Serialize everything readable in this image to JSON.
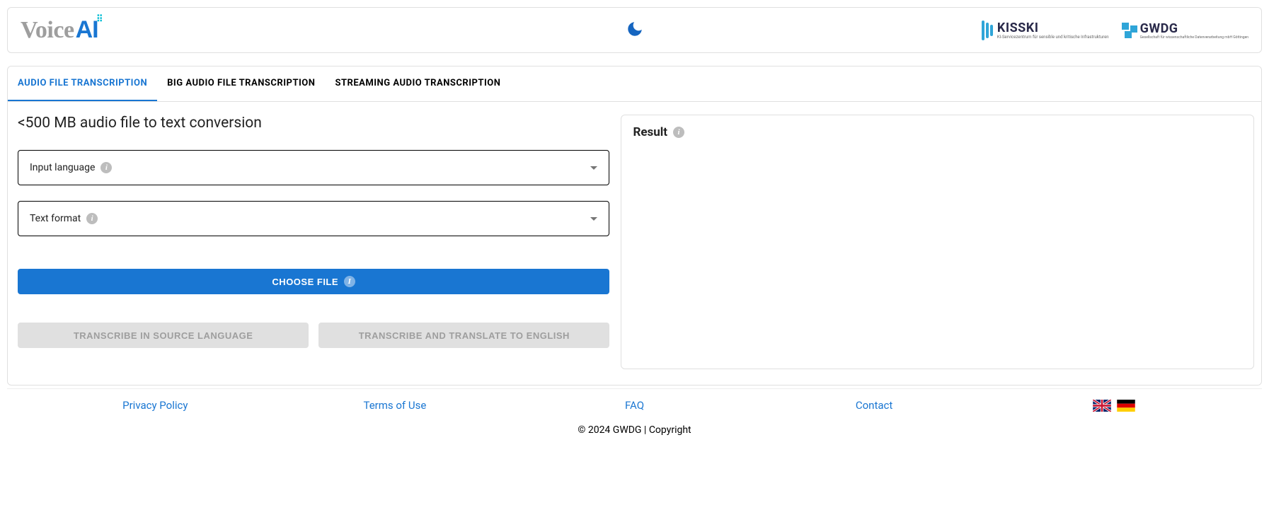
{
  "header": {
    "logo_main": "Voice",
    "logo_ai": "AI"
  },
  "tabs": [
    {
      "label": "AUDIO FILE TRANSCRIPTION",
      "active": true
    },
    {
      "label": "BIG AUDIO FILE TRANSCRIPTION",
      "active": false
    },
    {
      "label": "STREAMING AUDIO TRANSCRIPTION",
      "active": false
    }
  ],
  "main": {
    "title": "<500 MB audio file to text conversion",
    "input_language_label": "Input language",
    "text_format_label": "Text format",
    "choose_file_label": "CHOOSE FILE",
    "transcribe_source_label": "TRANSCRIBE IN SOURCE LANGUAGE",
    "transcribe_english_label": "TRANSCRIBE AND TRANSLATE TO ENGLISH"
  },
  "result": {
    "title": "Result"
  },
  "footer": {
    "links": [
      "Privacy Policy",
      "Terms of Use",
      "FAQ",
      "Contact"
    ],
    "copyright": "© 2024 GWDG | Copyright"
  },
  "partners": {
    "kisski": "KISSKI",
    "kisski_sub": "KI-Servicezentrum für sensible und kritische Infrastrukturen",
    "gwdg": "GWDG",
    "gwdg_sub": "Gesellschaft für wissenschaftliche Datenverarbeitung mbH Göttingen"
  }
}
